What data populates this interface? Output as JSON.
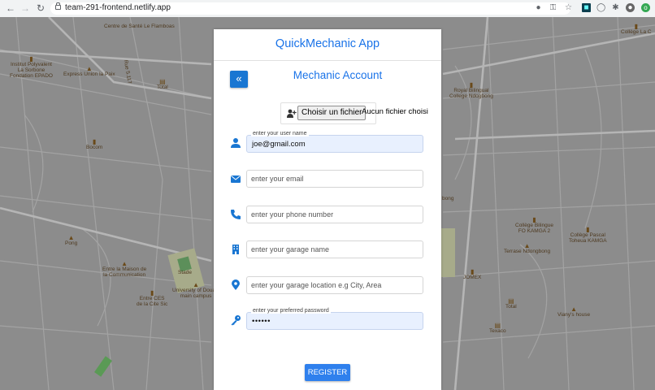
{
  "browser": {
    "url": "team-291-frontend.netlify.app",
    "back_icon": "arrow-left-icon",
    "forward_icon": "arrow-right-icon",
    "reload_icon": "reload-icon"
  },
  "map": {
    "labels": [
      "Centre de Santé\nLe Flamboas",
      "Institut Polyvalent\nLa Sorbone\nFondation EPADO",
      "Express Union la Paix",
      "Total",
      "Royal Bilingual\nCollege Ndogbong",
      "Bocom",
      "Collège Bilingue\nFO KAMGA 2",
      "Collège Pascal\nToheua KAMGA",
      "Terrase Ndongbong",
      "Pong",
      "Entre la Maison de\nla Communication",
      "Entre CES\nde la Cite Sic",
      "University of Douala\nmain campus",
      "JOMEX",
      "Total",
      "Texaco",
      "Viany's house",
      "Stade",
      "Collège La C",
      "Rue 5.117",
      "bong"
    ]
  },
  "app": {
    "title": "QuickMechanic App",
    "page_title": "Mechanic Account",
    "back_button_icon": "double-chevron-left-icon",
    "file_button": "Choisir un fichier",
    "file_status": "Aucun fichier choisi",
    "fields": {
      "username": {
        "label": "enter your user name",
        "value": "joe@gmail.com",
        "icon": "user-icon"
      },
      "email": {
        "placeholder": "enter your email",
        "icon": "envelope-icon"
      },
      "phone": {
        "placeholder": "enter your phone number",
        "icon": "phone-icon"
      },
      "garage_name": {
        "placeholder": "enter your garage name",
        "icon": "building-icon"
      },
      "garage_location": {
        "placeholder": "enter your garage location e.g City, Area",
        "icon": "map-marker-icon"
      },
      "password": {
        "label": "enter your preferred password",
        "value": "••••••",
        "icon": "key-icon"
      }
    },
    "register_label": "REGISTER"
  },
  "colors": {
    "primary": "#1a73e8",
    "button": "#2f80ed",
    "icon": "#1976d2",
    "autofill": "#e8f0fe",
    "map": "#8c8c8c"
  }
}
